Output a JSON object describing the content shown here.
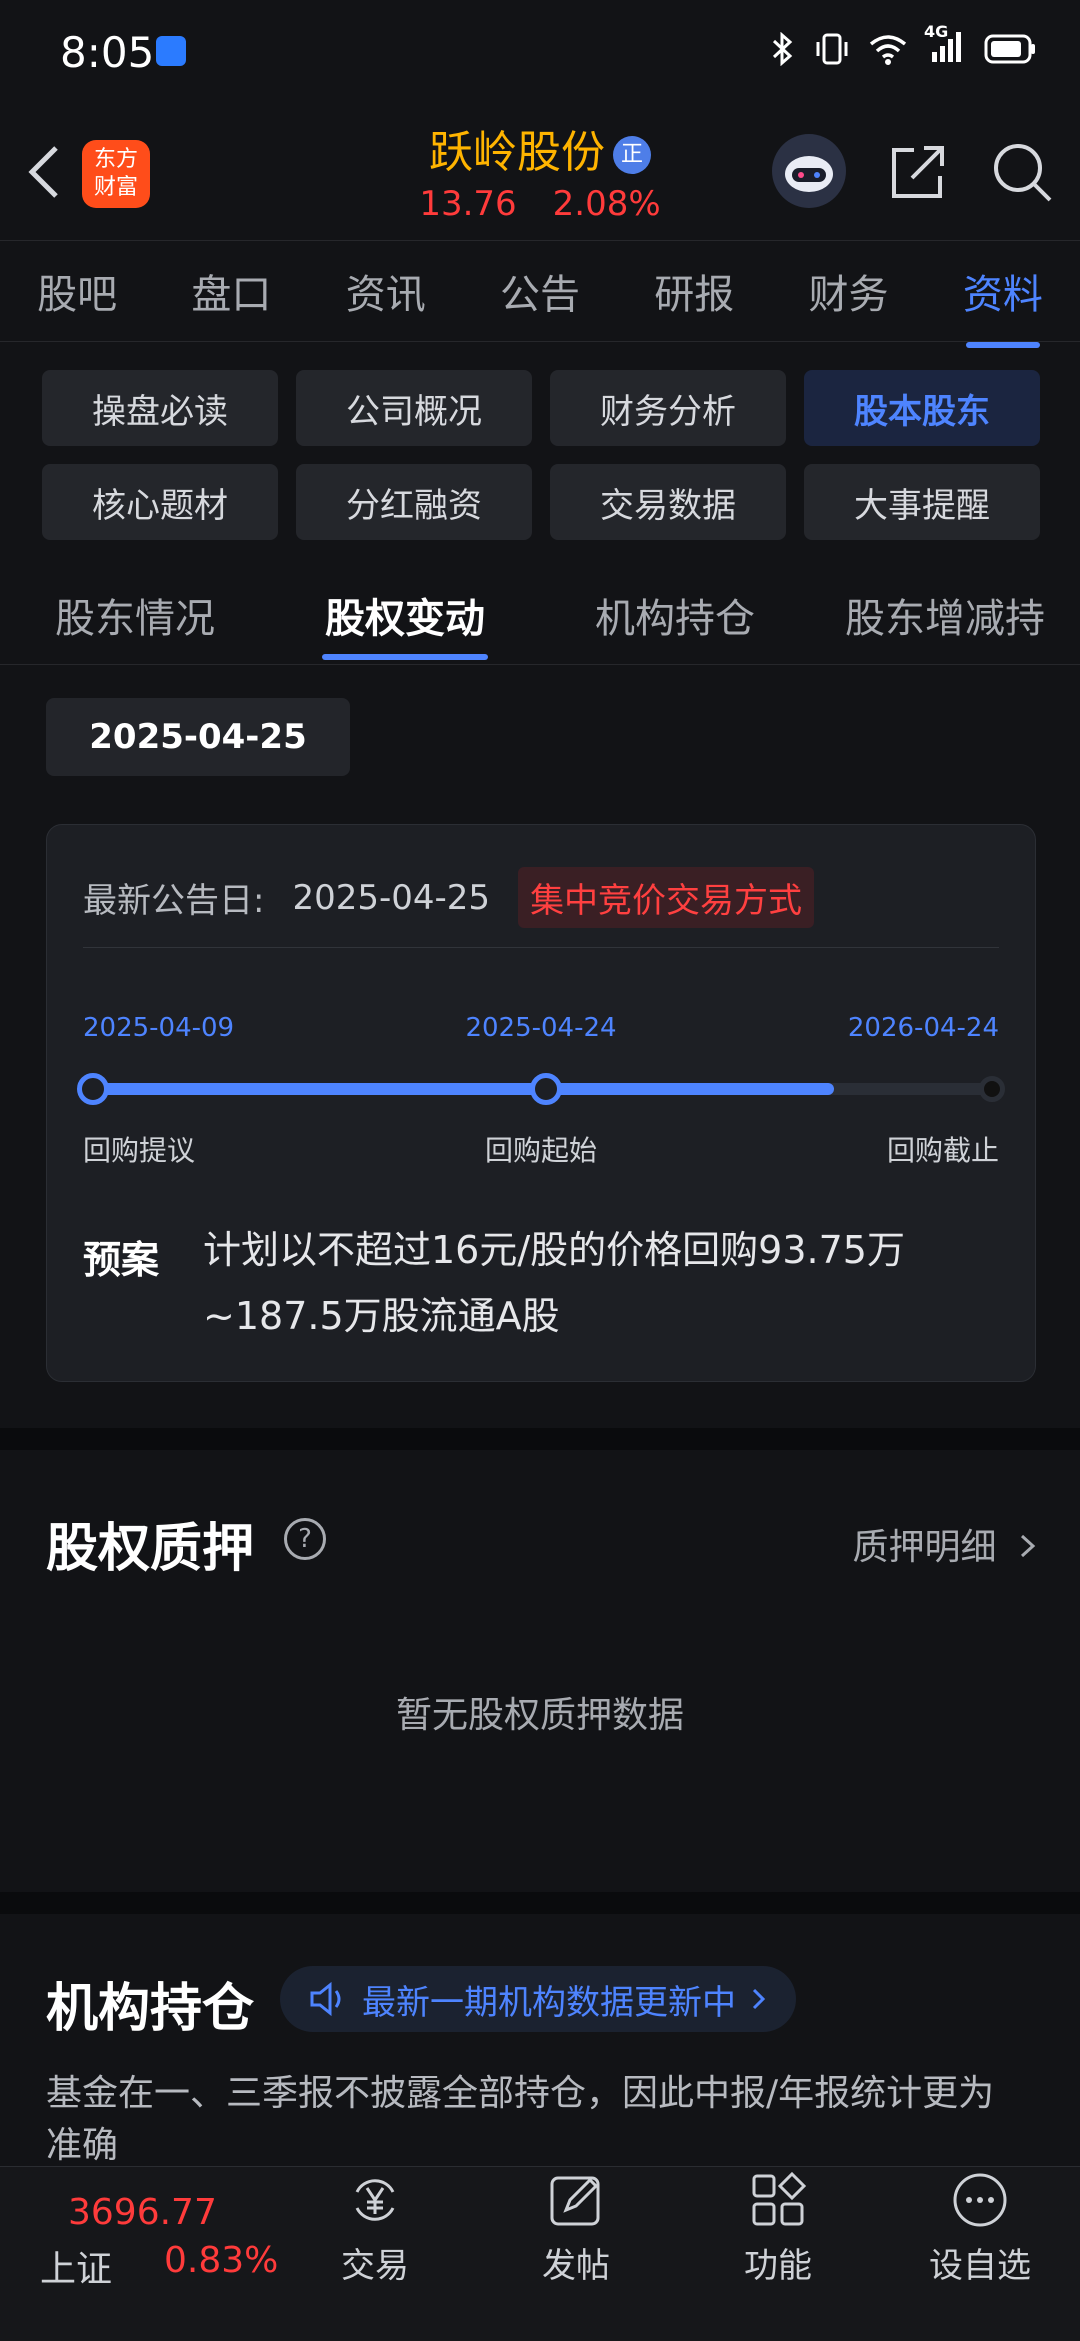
{
  "status_bar": {
    "time": "8:05",
    "network": "4G"
  },
  "header": {
    "back_icon": "chevron-left-icon",
    "logo_lines": [
      "东方",
      "财富"
    ],
    "stock_name": "跃岭股份",
    "badge": "正",
    "price": "13.76",
    "change_pct": "2.08%",
    "right_icons": [
      "robot-avatar-icon",
      "share-icon",
      "search-icon"
    ]
  },
  "nav_tabs": [
    {
      "label": "股吧"
    },
    {
      "label": "盘口"
    },
    {
      "label": "资讯"
    },
    {
      "label": "公告"
    },
    {
      "label": "研报"
    },
    {
      "label": "财务"
    },
    {
      "label": "资料",
      "active": true
    }
  ],
  "chips": [
    {
      "label": "操盘必读"
    },
    {
      "label": "公司概况"
    },
    {
      "label": "财务分析"
    },
    {
      "label": "股本股东",
      "active": true
    },
    {
      "label": "核心题材"
    },
    {
      "label": "分红融资"
    },
    {
      "label": "交易数据"
    },
    {
      "label": "大事提醒"
    }
  ],
  "sub_tabs": [
    {
      "label": "股东情况"
    },
    {
      "label": "股权变动",
      "active": true
    },
    {
      "label": "机构持仓"
    },
    {
      "label": "股东增减持"
    }
  ],
  "date_filter": "2025-04-25",
  "buyback": {
    "announce_label": "最新公告日:",
    "announce_date": "2025-04-25",
    "method_tag": "集中竞价交易方式",
    "timeline": {
      "dates": [
        "2025-04-09",
        "2025-04-24",
        "2026-04-24"
      ],
      "labels": [
        "回购提议",
        "回购起始",
        "回购截止"
      ],
      "progress": 0.82
    },
    "plan_label": "预案",
    "plan_text": "计划以不超过16元/股的价格回购93.75万~187.5万股流通A股"
  },
  "pledge": {
    "title": "股权质押",
    "link": "质押明细",
    "empty_text": "暂无股权质押数据"
  },
  "institution": {
    "title": "机构持仓",
    "banner": "最新一期机构数据更新中",
    "note": "基金在一、三季报不披露全部持仓，因此中报/年报统计更为准确"
  },
  "bottom_bar": {
    "index_value": "3696.77",
    "index_name": "上证",
    "index_pct": "0.83%",
    "items": [
      {
        "label": "交易",
        "icon": "yen-exchange-icon"
      },
      {
        "label": "发帖",
        "icon": "edit-post-icon"
      },
      {
        "label": "功能",
        "icon": "grid-apps-icon"
      },
      {
        "label": "设自选",
        "icon": "more-circle-icon"
      }
    ]
  },
  "colors": {
    "accent": "#4e84ff",
    "up": "#ff3b3b",
    "title": "#ffb400"
  }
}
